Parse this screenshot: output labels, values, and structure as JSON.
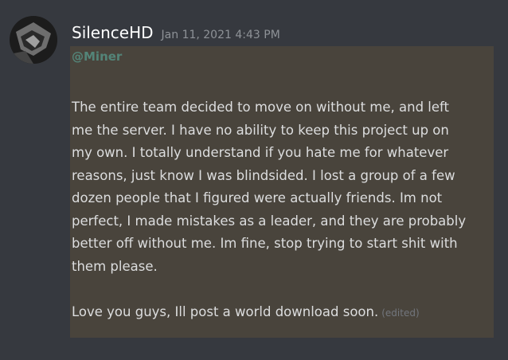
{
  "message": {
    "username": "SilenceHD",
    "timestamp": "Jan 11, 2021 4:43 PM",
    "mention": "@Miner",
    "paragraph1_lines": [
      "The entire team decided to move on without me, and left",
      "me the server. I have no ability to keep this project up on",
      "my own. I totally understand if you hate me for whatever",
      "reasons, just know I was blindsided. I lost a group of a few",
      "dozen people that I figured were actually friends. Im not",
      "perfect, I made mistakes as a leader, and they are probably",
      "better off without me. Im fine, stop trying to start shit with",
      "them please."
    ],
    "paragraph2": "Love you guys, Ill post a world download soon.",
    "edited_label": "(edited)"
  },
  "colors": {
    "background": "#36393f",
    "mention_highlight": "#49443c",
    "mention_text": "#5cb9a9",
    "username": "#ffffff",
    "timestamp": "#8e9297"
  },
  "icons": {
    "avatar": "user-avatar"
  }
}
